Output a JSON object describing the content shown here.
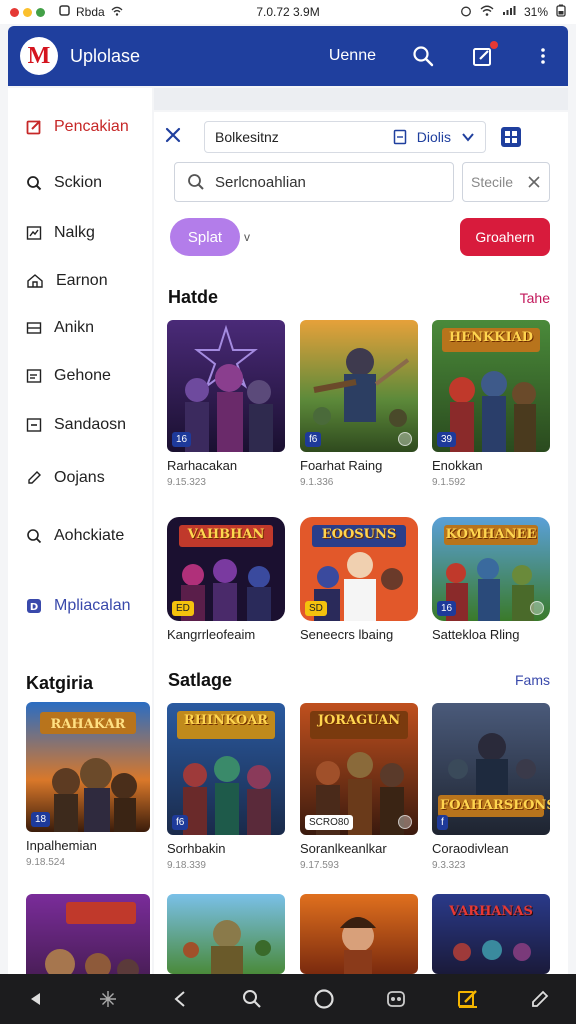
{
  "status": {
    "left_label": "Rbda",
    "time": "7.0.72 3.9M",
    "battery": "31%",
    "dot_colors": [
      "#e53935",
      "#fbc02d",
      "#43a047"
    ]
  },
  "appbar": {
    "logo_letter": "M",
    "title": "Uplolase",
    "link": "Uenne",
    "icons": [
      "search-icon",
      "edit-icon",
      "more-vertical-icon"
    ]
  },
  "sidebar": {
    "items": [
      {
        "label": "Pencakian",
        "icon": "edit-square-icon"
      },
      {
        "label": "Sckion",
        "icon": "search-icon"
      },
      {
        "label": "Nalkg",
        "icon": "chart-icon"
      },
      {
        "label": "Earnon",
        "icon": "home-icon"
      },
      {
        "label": "Anikn",
        "icon": "list-icon"
      },
      {
        "label": "Gehone",
        "icon": "doc-icon"
      },
      {
        "label": "Sandaosn",
        "icon": "minus-square-icon"
      },
      {
        "label": "Oojans",
        "icon": "pencil-icon"
      },
      {
        "label": "Aohckiate",
        "icon": "search-icon"
      },
      {
        "label": "Mpliacalan",
        "icon": "d-badge-icon"
      }
    ],
    "category_title": "Katgiria",
    "cards": [
      {
        "title": "Inpalhemian",
        "meta": "9.18.524",
        "badge": "18"
      },
      {
        "title": "",
        "meta": "",
        "badge": ""
      }
    ]
  },
  "toolbar": {
    "tab_label": "Bolkesitnz",
    "tab_right": "Diolis"
  },
  "search": {
    "placeholder": "Serlcnoahlian",
    "small_placeholder": "Stecile"
  },
  "chip": {
    "label": "Splat",
    "caret": "v"
  },
  "red_button": {
    "label": "Groahern"
  },
  "sections": [
    {
      "title": "Hatde",
      "link": "Tahe",
      "link_color": "#c2185b",
      "cards": [
        {
          "title": "Rarhacakan",
          "meta": "9.15.323",
          "badge": "16",
          "badge_style": "blue"
        },
        {
          "title": "Foarhat Raing",
          "meta": "9.1.336",
          "badge": "f6",
          "badge_style": "blue"
        },
        {
          "title": "Enokkan",
          "meta": "9.1.592",
          "badge": "39",
          "badge_style": "blue",
          "banner": "HENKKIAD"
        },
        {
          "title": "Kangrrleofeaim",
          "meta": "",
          "badge": "ED",
          "badge_style": "y",
          "banner": "VAHBHAN"
        },
        {
          "title": "Seneecrs lbaing",
          "meta": "",
          "badge": "SD",
          "badge_style": "y",
          "banner": "EOOSUNS"
        },
        {
          "title": "Sattekloa Rling",
          "meta": "",
          "badge": "16",
          "badge_style": "blue",
          "banner": "KOMHANEE"
        }
      ]
    },
    {
      "title": "Satlage",
      "link": "Fams",
      "link_color": "#3949ab",
      "cards": [
        {
          "title": "Sorhbakin",
          "meta": "9.18.339",
          "badge": "f6",
          "badge_style": "blue",
          "banner": "RHINKOAR"
        },
        {
          "title": "Soranlkeanlkar",
          "meta": "9.17.593",
          "badge": "SCRO80",
          "badge_style": "w",
          "banner": "JORAGUAN"
        },
        {
          "title": "Coraodivlean",
          "meta": "9.3.323",
          "badge": "f",
          "badge_style": "blue",
          "banner": "FOAHARSEONS"
        },
        {
          "title": "",
          "meta": "",
          "badge": "",
          "badge_style": "blue",
          "banner": ""
        },
        {
          "title": "",
          "meta": "",
          "badge": "",
          "badge_style": "blue",
          "banner": ""
        },
        {
          "title": "",
          "meta": "",
          "badge": "",
          "badge_style": "blue",
          "banner": "VARHANAS"
        }
      ]
    }
  ],
  "navbar": {
    "icons": [
      "back-arrow-icon",
      "sparkle-icon",
      "chevron-left-icon",
      "search-icon",
      "circle-home-icon",
      "gamepad-icon",
      "edit-note-icon",
      "pencil-icon"
    ],
    "active_color": "#f4b400"
  },
  "colors": {
    "primary": "#1f3f9e",
    "accent_red": "#d81b3c",
    "chip_purple": "#b37dea"
  }
}
